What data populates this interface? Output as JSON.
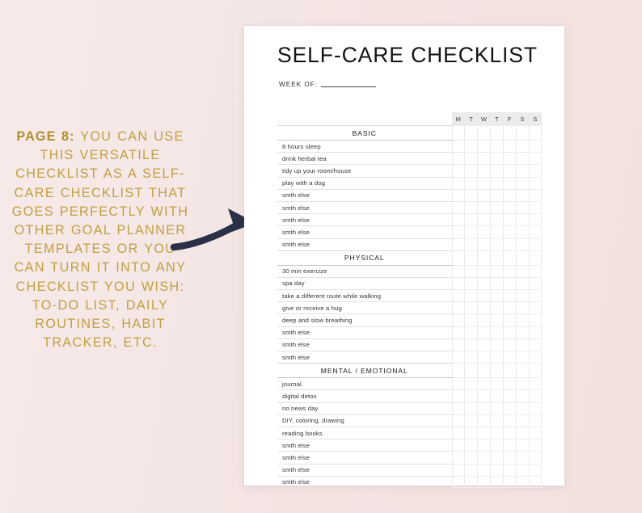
{
  "promo": {
    "lead": "PAGE 8:",
    "body": " YOU CAN USE THIS VERSATILE CHECKLIST AS A SELF-CARE CHECKLIST THAT GOES PERFECTLY WITH OTHER GOAL PLANNER TEMPLATES OR YOU CAN TURN IT INTO ANY CHECKLIST YOU WISH: TO-DO LIST, DAILY ROUTINES, HABIT TRACKER, ETC.",
    "color_gold": "#c0a042",
    "color_gold_bold": "#b08f2e"
  },
  "arrow": {
    "icon": "curved-arrow-right-icon",
    "color": "#2b3047"
  },
  "page": {
    "title": "SELF-CARE CHECKLIST",
    "week_of_label": "WEEK OF:",
    "week_of_value": "",
    "background": "#ffffff"
  },
  "table": {
    "day_headers": [
      "M",
      "T",
      "W",
      "T",
      "F",
      "S",
      "S"
    ],
    "day_header_bg": "#ebebeb",
    "sections": [
      {
        "title": "BASIC",
        "items": [
          "8 hours sleep",
          "drink herbal tea",
          "tidy up your room/house",
          "play with a dog",
          "smth else",
          "smth else",
          "smth else",
          "smth else",
          "smth else"
        ]
      },
      {
        "title": "PHYSICAL",
        "items": [
          "30 min exercize",
          "spa day",
          "take a different route while walking",
          "give or receive a hug",
          "deep and slow breathing",
          "smth else",
          "smth else",
          "smth else"
        ]
      },
      {
        "title": "MENTAL / EMOTIONAL",
        "items": [
          "journal",
          "digital detox",
          "no news day",
          "DIY, coloring, drawing",
          "reading books",
          "smth else",
          "smth else",
          "smth else",
          "smth else"
        ]
      }
    ]
  },
  "canvas": {
    "background": "#f3e6e4"
  }
}
